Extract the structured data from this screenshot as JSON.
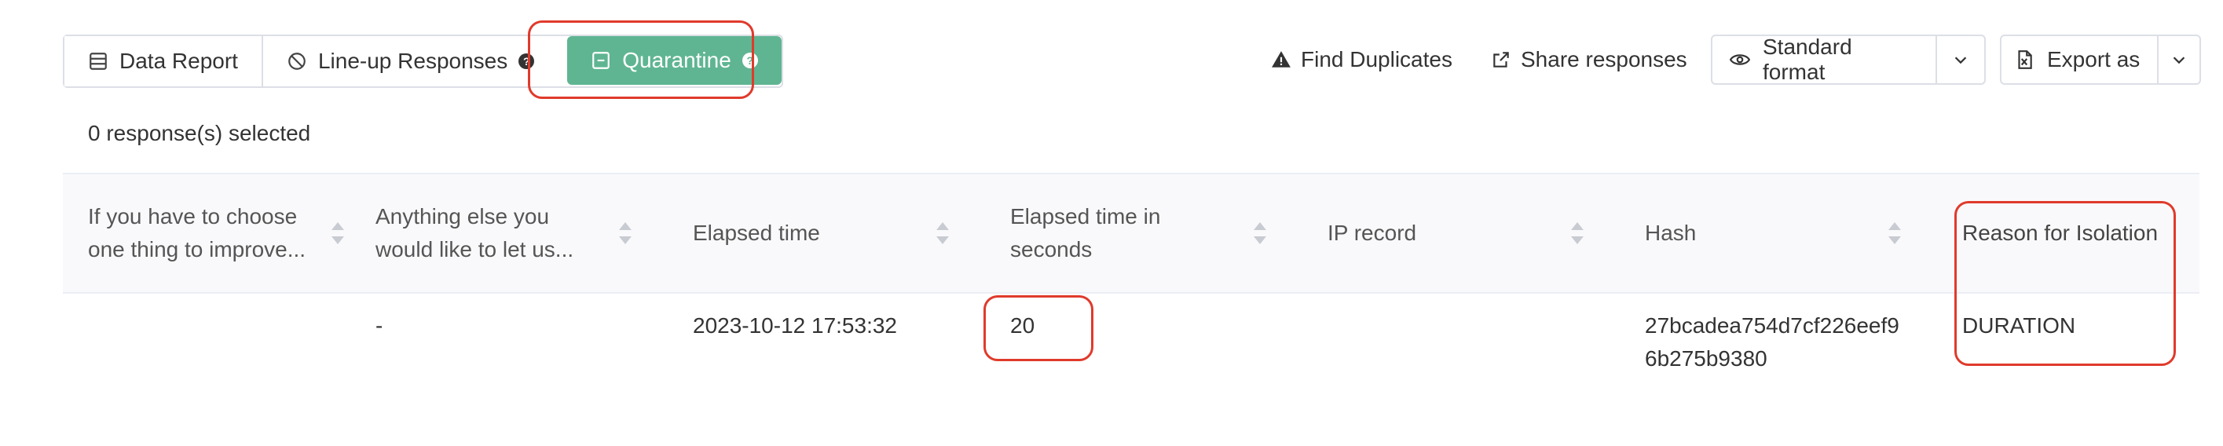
{
  "toolbar": {
    "tabs": [
      {
        "label": "Data Report",
        "icon": "table-icon"
      },
      {
        "label": "Line-up Responses",
        "icon": "ban-icon"
      },
      {
        "label": "Quarantine",
        "icon": "minus-square-icon"
      }
    ],
    "find_duplicates": "Find Duplicates",
    "share_responses": "Share responses",
    "format_label": "Standard format",
    "export_label": "Export as"
  },
  "selection": {
    "count_text": "0 response(s) selected"
  },
  "table": {
    "columns": [
      {
        "label": "If you have to choose one thing to improve..."
      },
      {
        "label": "Anything else you would like to let us..."
      },
      {
        "label": "Elapsed time"
      },
      {
        "label": "Elapsed time in seconds"
      },
      {
        "label": "IP record"
      },
      {
        "label": "Hash"
      },
      {
        "label": "Reason for Isolation"
      }
    ],
    "rows": [
      {
        "cells": [
          "",
          "-",
          "2023-10-12 17:53:32",
          "20",
          "",
          "27bcadea754d7cf226eef96b275b9380",
          "DURATION"
        ]
      }
    ]
  },
  "colors": {
    "accent": "#5fb592",
    "highlight": "#e03a2b",
    "header_bg": "#f9f9fb"
  }
}
